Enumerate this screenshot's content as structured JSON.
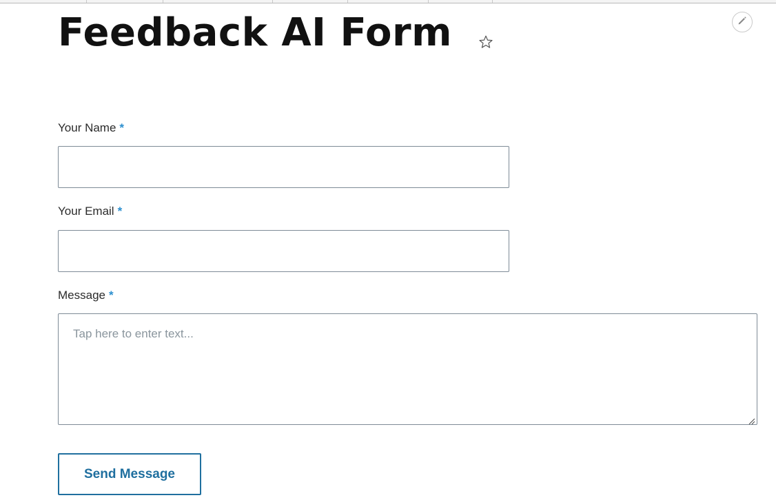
{
  "page": {
    "title": "Feedback AI Form"
  },
  "form": {
    "required_marker": "*",
    "name_label": "Your Name",
    "name_value": "",
    "email_label": "Your Email",
    "email_value": "",
    "message_label": "Message",
    "message_placeholder": "Tap here to enter text...",
    "message_value": "",
    "submit_label": "Send Message"
  },
  "icons": {
    "favorite": "star-outline-icon",
    "edit": "pencil-icon",
    "resize": "resize-grip-icon"
  },
  "colors": {
    "accent": "#1f6f9f",
    "required": "#2c8fcf",
    "title": "#111111",
    "border": "#7d8a96"
  }
}
